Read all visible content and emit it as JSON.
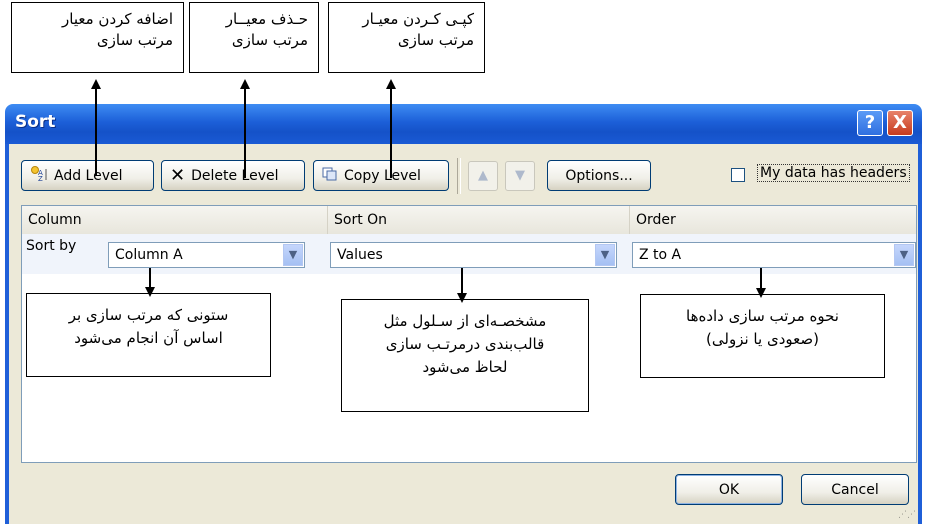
{
  "callouts": {
    "add_level": {
      "line1": "اضافه کردن معیار",
      "line2": "مرتب سازی"
    },
    "delete_level": {
      "line1": "حـذف معیــار",
      "line2": "مرتب سازی"
    },
    "copy_level": {
      "line1": "کپـی کـردن معیـار",
      "line2": "مرتب سازی"
    },
    "column_note": {
      "line1": "ستونی که مرتب سازی بر",
      "line2": "اساس آن انجام می‌شود"
    },
    "sort_on_note": {
      "line1": "مشخصـه‌ای از سـلول مثل",
      "line2": "قالب‌بندی درمرتـب سازی",
      "line3": "لحاظ می‌شود"
    },
    "order_note": {
      "line1": "نحوه مرتب سازی داده‌ها",
      "line2": "(صعودی یا نزولی)"
    }
  },
  "dialog": {
    "title": "Sort",
    "help": "?",
    "close": "X",
    "toolbar": {
      "add_level": "Add Level",
      "delete_level": "Delete Level",
      "copy_level": "Copy Level",
      "move_up": "▲",
      "move_down": "▼",
      "options": "Options..."
    },
    "headers_checkbox": {
      "label": "My data has headers",
      "checked": false
    },
    "grid": {
      "columns": [
        "Column",
        "Sort On",
        "Order"
      ],
      "rows": [
        {
          "label": "Sort by",
          "column": "Column A",
          "sort_on": "Values",
          "order": "Z to A"
        }
      ]
    },
    "ok": "OK",
    "cancel": "Cancel"
  }
}
